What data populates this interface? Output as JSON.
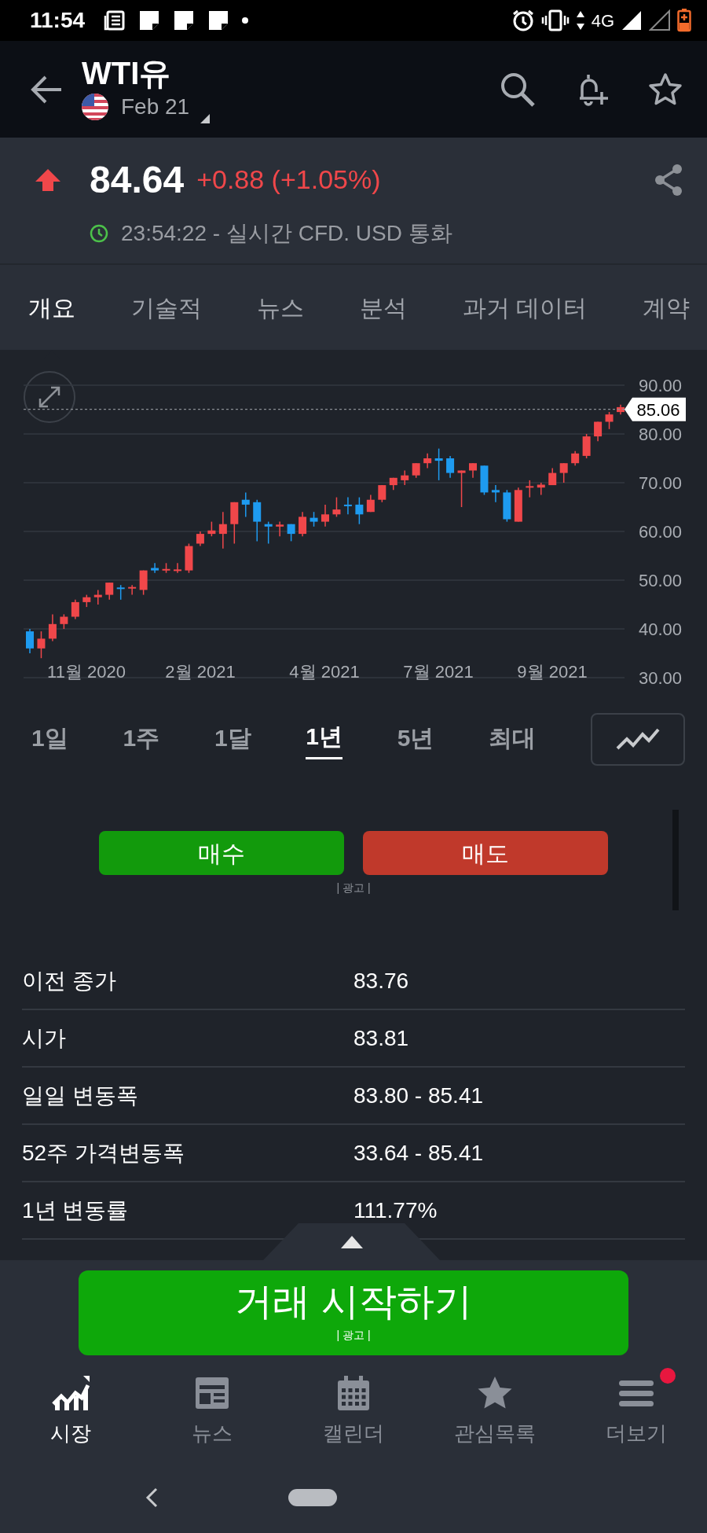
{
  "status_bar": {
    "time": "11:54",
    "network": "4G"
  },
  "header": {
    "title": "WTI유",
    "contract": "Feb 21"
  },
  "quote": {
    "rising": true,
    "price": "84.64",
    "change": "+0.88 (+1.05%)",
    "time_info": "23:54:22 - 실시간 CFD. USD 통화"
  },
  "tabs": [
    {
      "label": "개요",
      "selected": true
    },
    {
      "label": "기술적",
      "selected": false
    },
    {
      "label": "뉴스",
      "selected": false
    },
    {
      "label": "분석",
      "selected": false
    },
    {
      "label": "과거 데이터",
      "selected": false
    },
    {
      "label": "계약",
      "selected": false
    }
  ],
  "chart": {
    "x_axis_labels": [
      "11월 2020",
      "2월 2021",
      "4월 2021",
      "7월 2021",
      "9월 2021"
    ],
    "chart_data": {
      "type": "candlestick",
      "ylim": [
        30,
        90
      ],
      "grid": true,
      "ref_lines": [
        {
          "axis": "y",
          "value": 85.06,
          "label": "85.06"
        }
      ],
      "yticks": [
        {
          "value": 90,
          "label": "90.00"
        },
        {
          "value": 80,
          "label": "80.00"
        },
        {
          "value": 70,
          "label": "70.00"
        },
        {
          "value": 60,
          "label": "60.00"
        },
        {
          "value": 50,
          "label": "50.00"
        },
        {
          "value": 40,
          "label": "40.00"
        },
        {
          "value": 30,
          "label": "30.00"
        }
      ],
      "ohlc": [
        [
          39.5,
          40,
          35,
          36
        ],
        [
          36,
          39.5,
          34,
          38
        ],
        [
          38,
          43,
          37.5,
          41
        ],
        [
          41,
          43,
          40,
          42.5
        ],
        [
          42.5,
          46,
          42,
          45.5
        ],
        [
          45.5,
          47,
          44.5,
          46.5
        ],
        [
          46.5,
          48,
          45,
          47
        ],
        [
          47,
          49.5,
          46,
          49.5
        ],
        [
          48.5,
          49,
          46,
          48.3
        ],
        [
          48.3,
          49,
          47,
          48.6
        ],
        [
          48,
          52,
          47,
          52
        ],
        [
          52.5,
          53.5,
          51.5,
          52
        ],
        [
          52,
          53.5,
          51.5,
          52.3
        ],
        [
          52,
          53.5,
          51.5,
          52.2
        ],
        [
          52,
          57.5,
          51.5,
          57
        ],
        [
          57.5,
          60,
          57,
          59.5
        ],
        [
          59.5,
          62,
          59,
          60.2
        ],
        [
          59.5,
          64,
          56.5,
          61.5
        ],
        [
          61.5,
          66,
          57.5,
          66
        ],
        [
          66.5,
          68,
          63,
          65.5
        ],
        [
          66,
          66.5,
          58,
          62
        ],
        [
          61.5,
          62,
          57.5,
          61
        ],
        [
          61,
          62,
          59,
          61.4
        ],
        [
          61.5,
          61.5,
          58,
          59.5
        ],
        [
          59.5,
          64,
          59,
          63
        ],
        [
          62.8,
          64,
          61,
          62
        ],
        [
          62,
          65.5,
          61,
          63.5
        ],
        [
          63.5,
          67,
          63,
          64.5
        ],
        [
          65.5,
          67,
          63.5,
          65.3
        ],
        [
          65.5,
          67,
          61.5,
          63.5
        ],
        [
          64,
          67.5,
          64,
          66.5
        ],
        [
          66.5,
          69.5,
          66,
          69.5
        ],
        [
          69.5,
          71,
          68.5,
          71
        ],
        [
          70.5,
          72.5,
          69.5,
          71.5
        ],
        [
          71.5,
          74,
          71,
          74
        ],
        [
          74,
          76,
          73,
          75
        ],
        [
          75,
          77,
          70.5,
          74.5
        ],
        [
          75,
          75.5,
          71,
          72
        ],
        [
          72,
          72.5,
          65,
          72.5
        ],
        [
          72.5,
          74,
          71,
          74
        ],
        [
          73.5,
          73.5,
          67.5,
          68
        ],
        [
          68.5,
          69.5,
          66,
          68
        ],
        [
          68,
          68.5,
          62,
          62.5
        ],
        [
          62,
          69,
          62,
          68.5
        ],
        [
          69,
          70.5,
          67,
          69.3
        ],
        [
          69,
          70,
          67.5,
          69.6
        ],
        [
          69.5,
          73,
          69.5,
          72
        ],
        [
          72,
          74,
          70,
          74
        ],
        [
          74,
          76.5,
          73.5,
          76
        ],
        [
          75.5,
          80,
          75,
          79.5
        ],
        [
          79.5,
          82.5,
          78.5,
          82.5
        ],
        [
          82.5,
          84.5,
          81,
          84
        ],
        [
          84.5,
          86,
          84,
          85.5
        ]
      ]
    }
  },
  "ranges": [
    {
      "label": "1일",
      "selected": false
    },
    {
      "label": "1주",
      "selected": false
    },
    {
      "label": "1달",
      "selected": false
    },
    {
      "label": "1년",
      "selected": true
    },
    {
      "label": "5년",
      "selected": false
    },
    {
      "label": "최대",
      "selected": false
    }
  ],
  "trade_buttons": [
    {
      "label": "매수",
      "kind": "buy"
    },
    {
      "label": "매도",
      "kind": "sell"
    }
  ],
  "trade_ad_label": "| 광고 |",
  "stats": [
    {
      "label": "이전 종가",
      "value": "83.76"
    },
    {
      "label": "시가",
      "value": "83.81"
    },
    {
      "label": "일일 변동폭",
      "value": "83.80 - 85.41"
    },
    {
      "label": "52주 가격변동폭",
      "value": "33.64 - 85.41"
    },
    {
      "label": "1년 변동률",
      "value": "111.77%"
    }
  ],
  "cta": {
    "label": "거래 시작하기",
    "ad_label": "| 광고 |"
  },
  "bottom_nav": [
    {
      "label": "시장",
      "selected": true,
      "notification": false
    },
    {
      "label": "뉴스",
      "selected": false,
      "notification": false
    },
    {
      "label": "캘린더",
      "selected": false,
      "notification": false
    },
    {
      "label": "관심목록",
      "selected": false,
      "notification": false
    },
    {
      "label": "더보기",
      "selected": false,
      "notification": true
    }
  ]
}
